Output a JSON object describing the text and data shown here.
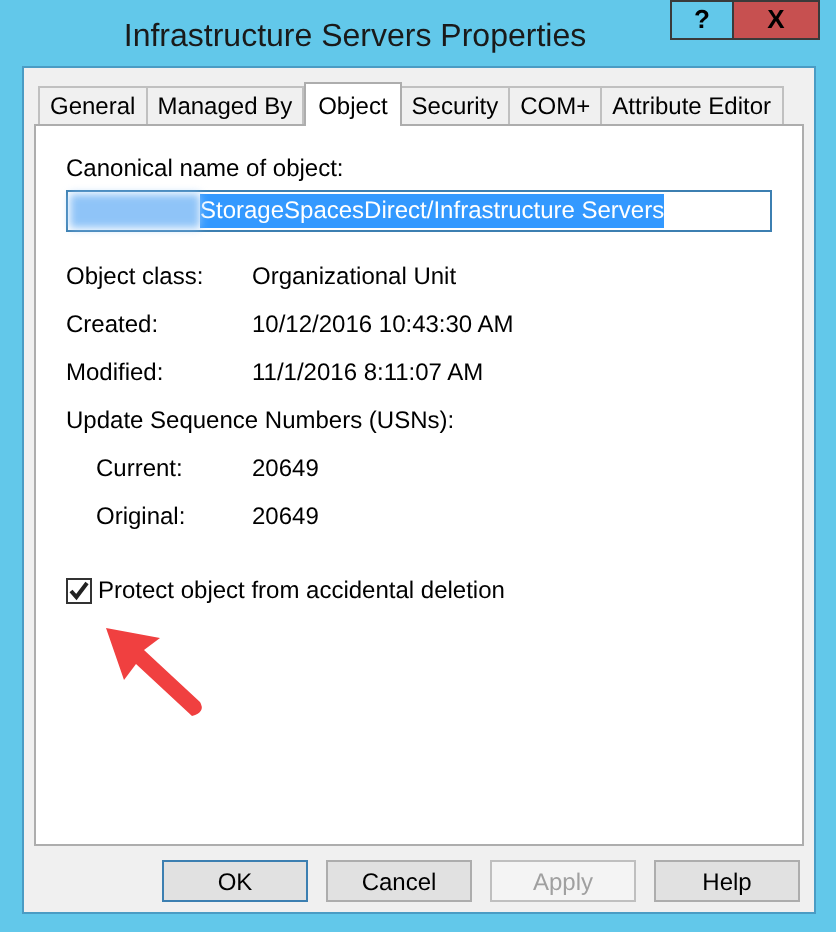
{
  "window": {
    "title": "Infrastructure Servers Properties",
    "help_button": "?",
    "close_button": "X"
  },
  "tabs": [
    {
      "label": "General",
      "selected": false
    },
    {
      "label": "Managed By",
      "selected": false
    },
    {
      "label": "Object",
      "selected": true
    },
    {
      "label": "Security",
      "selected": false
    },
    {
      "label": "COM+",
      "selected": false
    },
    {
      "label": "Attribute Editor",
      "selected": false
    }
  ],
  "canonical_name": {
    "label": "Canonical name of object:",
    "value": "StorageSpacesDirect/Infrastructure Servers",
    "selected": true
  },
  "fields": [
    {
      "label": "Object class:",
      "value": "Organizational Unit"
    },
    {
      "label": "Created:",
      "value": "10/12/2016 10:43:30 AM"
    },
    {
      "label": "Modified:",
      "value": "11/1/2016 8:11:07 AM"
    }
  ],
  "usn": {
    "heading": "Update Sequence Numbers (USNs):",
    "rows": [
      {
        "label": "Current:",
        "value": "20649"
      },
      {
        "label": "Original:",
        "value": "20649"
      }
    ]
  },
  "protect_checkbox": {
    "label": "Protect object from accidental deletion",
    "checked": true
  },
  "buttons": [
    {
      "label": "OK",
      "default": true,
      "disabled": false
    },
    {
      "label": "Cancel",
      "default": false,
      "disabled": false
    },
    {
      "label": "Apply",
      "default": false,
      "disabled": true
    },
    {
      "label": "Help",
      "default": false,
      "disabled": false
    }
  ]
}
